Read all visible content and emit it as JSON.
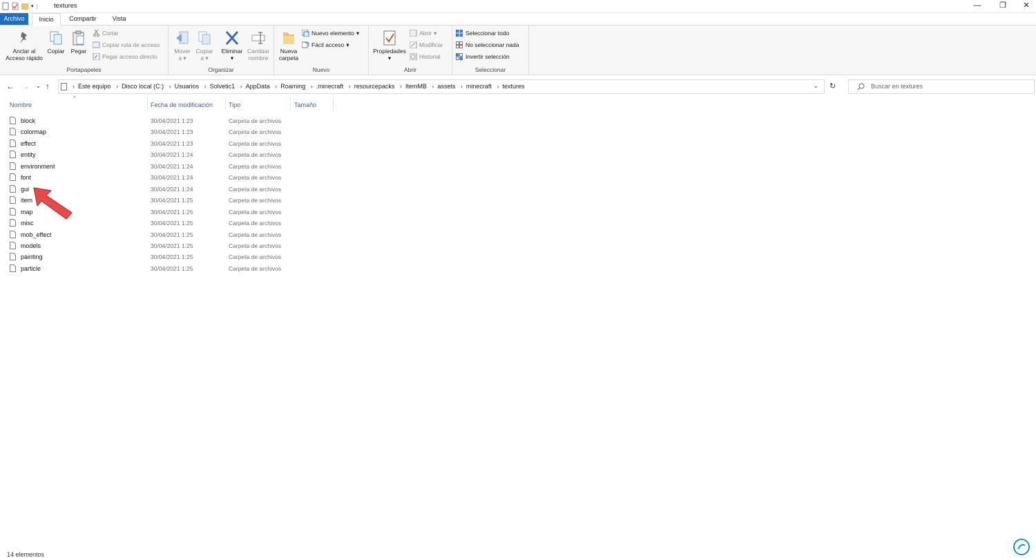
{
  "window": {
    "title": "textures",
    "controls": {
      "minimize": "—",
      "restore": "❐",
      "close": "✕"
    }
  },
  "tabs": {
    "file": "Archivo",
    "home": "Inicio",
    "share": "Compartir",
    "view": "Vista"
  },
  "ribbon": {
    "clipboard": {
      "label": "Portapapeles",
      "pin": "Anclar al Acceso rápido",
      "pin_l1": "Anclar al",
      "pin_l2": "Acceso rápido",
      "copy": "Copiar",
      "paste": "Pegar",
      "cut": "Cortar",
      "copy_path": "Copiar ruta de acceso",
      "paste_shortcut": "Pegar acceso directo"
    },
    "organize": {
      "label": "Organizar",
      "move_l1": "Mover",
      "move_l2": "a",
      "copy_l1": "Copiar",
      "copy_l2": "a",
      "delete": "Eliminar",
      "rename_l1": "Cambiar",
      "rename_l2": "nombre"
    },
    "new": {
      "label": "Nuevo",
      "folder_l1": "Nueva",
      "folder_l2": "carpeta",
      "new_item": "Nuevo elemento",
      "easy_access": "Fácil acceso"
    },
    "open": {
      "label": "Abrir",
      "properties": "Propiedades",
      "open": "Abrir",
      "edit": "Modificar",
      "history": "Historial"
    },
    "select": {
      "label": "Seleccionar",
      "select_all": "Seleccionar todo",
      "select_none": "No seleccionar nada",
      "invert": "Invertir selección"
    }
  },
  "address": {
    "crumbs": [
      "Este equipo",
      "Disco local (C:)",
      "Usuarios",
      "Solvetic1",
      "AppData",
      "Roaming",
      ".minecraft",
      "resourcepacks",
      "ItemMB",
      "assets",
      "minecraft",
      "textures"
    ],
    "search_placeholder": "Buscar en textures"
  },
  "columns": {
    "name": "Nombre",
    "date": "Fecha de modificación",
    "type": "Tipo",
    "size": "Tamaño"
  },
  "files": [
    {
      "name": "block",
      "date": "30/04/2021 1:23",
      "type": "Carpeta de archivos"
    },
    {
      "name": "colormap",
      "date": "30/04/2021 1:23",
      "type": "Carpeta de archivos"
    },
    {
      "name": "effect",
      "date": "30/04/2021 1:23",
      "type": "Carpeta de archivos"
    },
    {
      "name": "entity",
      "date": "30/04/2021 1:24",
      "type": "Carpeta de archivos"
    },
    {
      "name": "environment",
      "date": "30/04/2021 1:24",
      "type": "Carpeta de archivos"
    },
    {
      "name": "font",
      "date": "30/04/2021 1:24",
      "type": "Carpeta de archivos"
    },
    {
      "name": "gui",
      "date": "30/04/2021 1:24",
      "type": "Carpeta de archivos"
    },
    {
      "name": "item",
      "date": "30/04/2021 1:25",
      "type": "Carpeta de archivos"
    },
    {
      "name": "map",
      "date": "30/04/2021 1:25",
      "type": "Carpeta de archivos"
    },
    {
      "name": "misc",
      "date": "30/04/2021 1:25",
      "type": "Carpeta de archivos"
    },
    {
      "name": "mob_effect",
      "date": "30/04/2021 1:25",
      "type": "Carpeta de archivos"
    },
    {
      "name": "models",
      "date": "30/04/2021 1:25",
      "type": "Carpeta de archivos"
    },
    {
      "name": "painting",
      "date": "30/04/2021 1:25",
      "type": "Carpeta de archivos"
    },
    {
      "name": "particle",
      "date": "30/04/2021 1:25",
      "type": "Carpeta de archivos"
    }
  ],
  "status": "14 elementos",
  "colors": {
    "accent": "#1e6fc2",
    "arrow": "#e84a4a",
    "header_text": "#4c607a"
  }
}
